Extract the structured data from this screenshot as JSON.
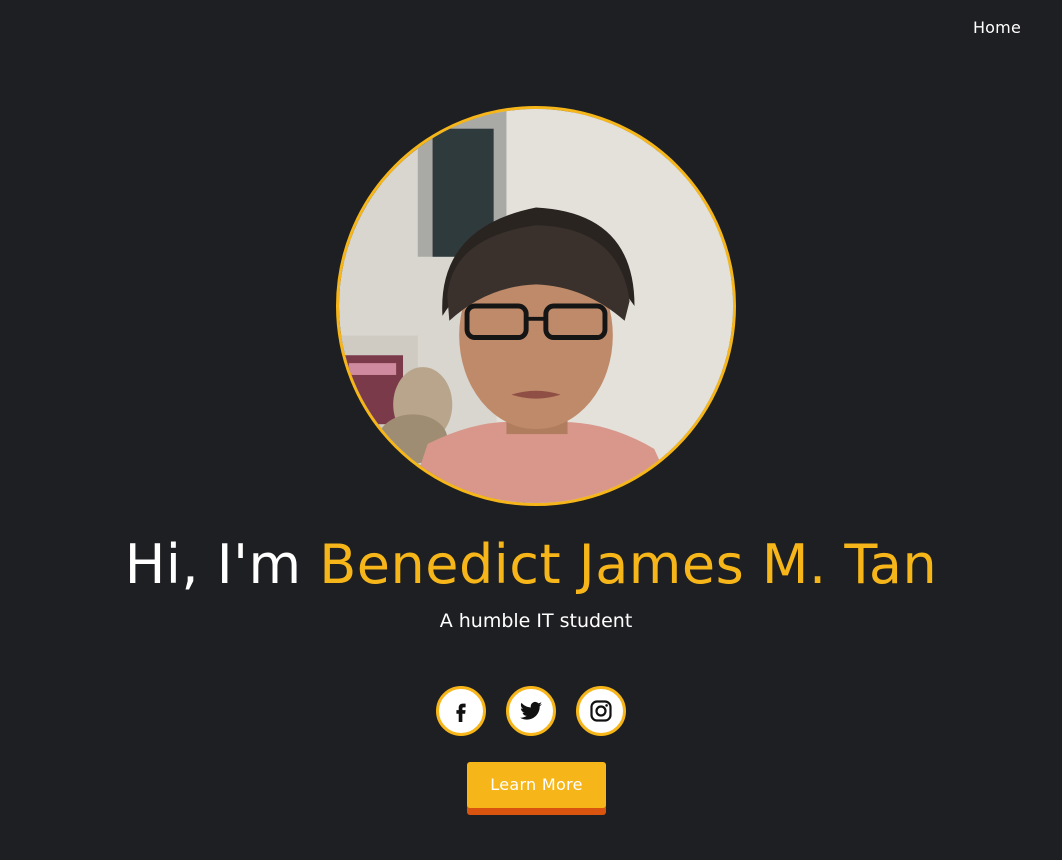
{
  "nav": {
    "home_label": "Home"
  },
  "profile": {
    "photo_icon": "profile-photo",
    "border_color": "#f6b619"
  },
  "hero": {
    "greeting": "Hi, I'm ",
    "name": "Benedict James M. Tan",
    "subtitle": "A humble IT student"
  },
  "socials": [
    {
      "icon": "facebook-icon"
    },
    {
      "icon": "twitter-icon"
    },
    {
      "icon": "instagram-icon"
    }
  ],
  "cta": {
    "label": "Learn More"
  },
  "colors": {
    "background": "#1e1f22",
    "accent": "#f6b619",
    "button_shadow": "#d8540f"
  }
}
